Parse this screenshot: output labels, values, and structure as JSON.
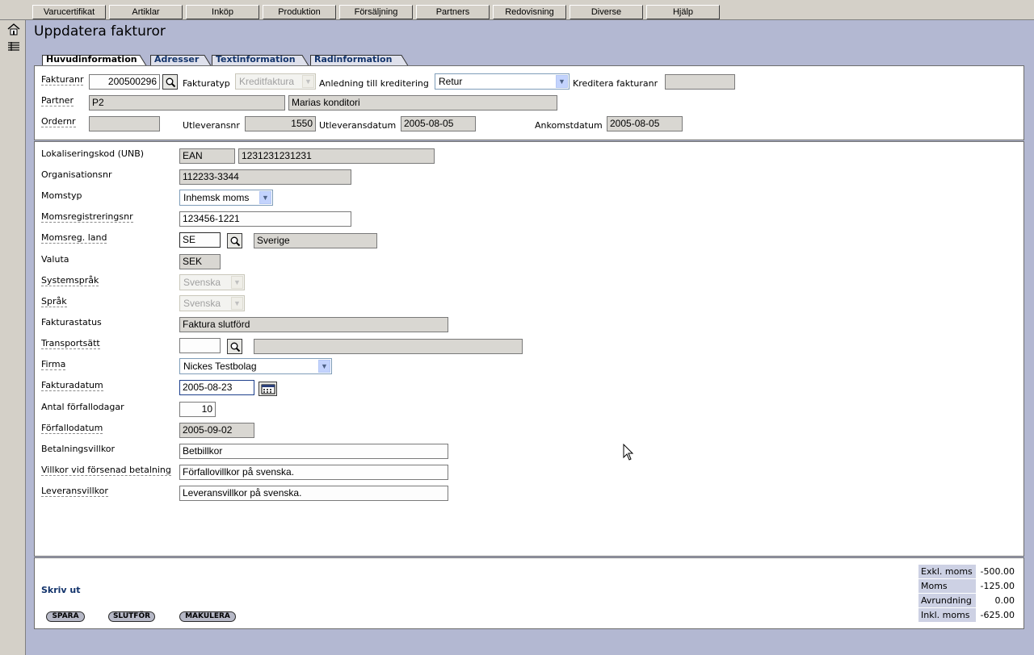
{
  "menu": [
    "Varucertifikat",
    "Artiklar",
    "Inköp",
    "Produktion",
    "Försäljning",
    "Partners",
    "Redovisning",
    "Diverse",
    "Hjälp"
  ],
  "page_title": "Uppdatera fakturor",
  "tabs": [
    "Huvudinformation",
    "Adresser",
    "Textinformation",
    "Radinformation"
  ],
  "header": {
    "fakturanr_label": "Fakturanr",
    "fakturanr": "200500296",
    "fakturatyp_label": "Fakturatyp",
    "fakturatyp": "Kreditfaktura",
    "anledning_label": "Anledning till kreditering",
    "anledning": "Retur",
    "kreditera_label": "Kreditera fakturanr",
    "kreditera": "",
    "partner_label": "Partner",
    "partner_code": "P2",
    "partner_name": "Marias konditori",
    "ordernr_label": "Ordernr",
    "ordernr": "",
    "utleveransnr_label": "Utleveransnr",
    "utleveransnr": "1550",
    "utleveransdatum_label": "Utleveransdatum",
    "utleveransdatum": "2005-08-05",
    "ankomstdatum_label": "Ankomstdatum",
    "ankomstdatum": "2005-08-05"
  },
  "details": {
    "lokaliseringskod_label": "Lokaliseringskod (UNB)",
    "lokaliseringskod_type": "EAN",
    "lokaliseringskod": "1231231231231",
    "orgnr_label": "Organisationsnr",
    "orgnr": "112233-3344",
    "momstyp_label": "Momstyp",
    "momstyp": "Inhemsk moms",
    "momsregnr_label": "Momsregistreringsnr",
    "momsregnr": "123456-1221",
    "momsland_label": "Momsreg. land",
    "momsland_code": "SE",
    "momsland_name": "Sverige",
    "valuta_label": "Valuta",
    "valuta": "SEK",
    "systemsprak_label": "Systemspråk",
    "systemsprak": "Svenska",
    "sprak_label": "Språk",
    "sprak": "Svenska",
    "fakturastatus_label": "Fakturastatus",
    "fakturastatus": "Faktura slutförd",
    "transportsatt_label": "Transportsätt",
    "transportsatt_code": "",
    "transportsatt_name": "",
    "firma_label": "Firma",
    "firma": "Nickes Testbolag",
    "fakturadatum_label": "Fakturadatum",
    "fakturadatum": "2005-08-23",
    "forfallodagar_label": "Antal förfallodagar",
    "forfallodagar": "10",
    "forfallodatum_label": "Förfallodatum",
    "forfallodatum": "2005-09-02",
    "betalningsvillkor_label": "Betalningsvillkor",
    "betalningsvillkor": "Betbillkor",
    "villkor_forsenad_label": "Villkor vid försenad betalning",
    "villkor_forsenad": "Förfallovillkor på svenska.",
    "leveransvillkor_label": "Leveransvillkor",
    "leveransvillkor": "Leveransvillkor på svenska."
  },
  "footer": {
    "print_link": "Skriv ut",
    "buttons": [
      "SPARA",
      "SLUTFÖR",
      "MAKULERA"
    ],
    "totals": [
      {
        "label": "Exkl. moms",
        "value": "-500.00"
      },
      {
        "label": "Moms",
        "value": "-125.00"
      },
      {
        "label": "Avrundning",
        "value": "0.00"
      },
      {
        "label": "Inkl. moms",
        "value": "-625.00"
      }
    ]
  },
  "colors": {
    "page_bg": "#b3b8d2",
    "link": "#12336b",
    "readonly_field": "#d9d7d2",
    "totals_key_bg": "#cdd1e4"
  }
}
